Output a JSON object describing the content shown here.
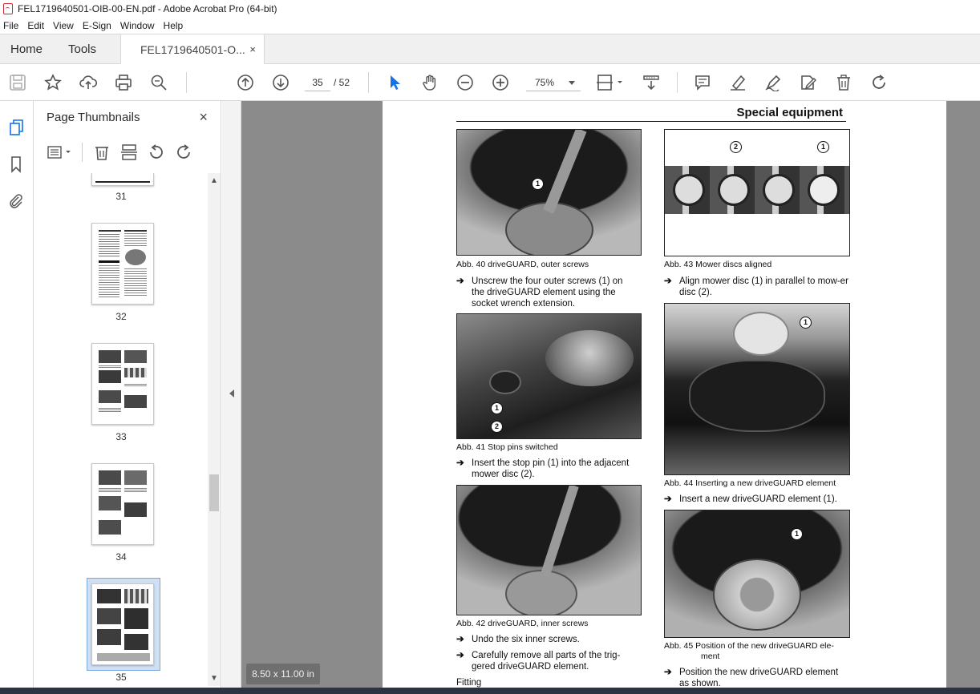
{
  "window": {
    "title": "FEL1719640501-OIB-00-EN.pdf - Adobe Acrobat Pro (64-bit)"
  },
  "menu": [
    "File",
    "Edit",
    "View",
    "E-Sign",
    "Window",
    "Help"
  ],
  "tabs": {
    "home": "Home",
    "tools": "Tools",
    "document": "FEL1719640501-O...",
    "close": "×"
  },
  "toolbar": {
    "current_page": "35",
    "page_total": "/ 52",
    "zoom": "75%"
  },
  "thumbnails": {
    "title": "Page Thumbnails",
    "close": "×",
    "pages": [
      {
        "label": "31"
      },
      {
        "label": "32"
      },
      {
        "label": "33"
      },
      {
        "label": "34"
      },
      {
        "label": "35",
        "selected": true
      }
    ]
  },
  "document": {
    "header": "Special equipment",
    "figures": [
      {
        "caption": "Abb. 40   driveGUARD, outer screws"
      },
      {
        "caption": "Abb. 41   Stop pins switched"
      },
      {
        "caption": "Abb. 42   driveGUARD, inner screws"
      },
      {
        "caption": "Abb. 43   Mower discs aligned"
      },
      {
        "caption": "Abb. 44   Inserting a new driveGUARD element"
      },
      {
        "caption_line1": "Abb. 45   Position of the new driveGUARD ele-",
        "caption_line2": "ment"
      }
    ],
    "steps": {
      "s1": "Unscrew the four outer screws (1) on the driveGUARD element using the socket wrench extension.",
      "s2": "Insert the stop pin (1) into the adjacent mower disc (2).",
      "s3": "Undo the six inner screws.",
      "s4": "Carefully remove all parts of the trig-gered driveGUARD element.",
      "s5": "Align mower disc (1) in parallel to mow-er disc (2).",
      "s6": "Insert a new driveGUARD element (1).",
      "s7": "Position the new driveGUARD element as shown."
    },
    "fitting_heading": "Fitting",
    "arrow_glyph": "➔",
    "callouts": {
      "one": "1",
      "two": "2"
    }
  },
  "status": {
    "page_size": "8.50 x 11.00 in"
  },
  "colors": {
    "accent": "#1473e6",
    "doc_bg": "#8b8b8b",
    "pdf_red": "#d4262d"
  }
}
